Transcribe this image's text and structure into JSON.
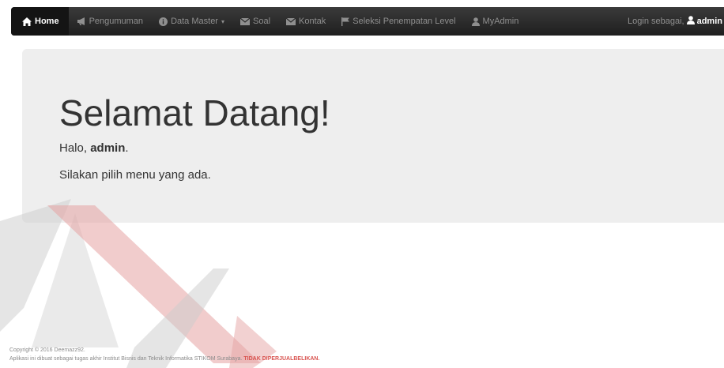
{
  "navbar": {
    "items": [
      {
        "label": "Home",
        "icon": "home-icon"
      },
      {
        "label": "Pengumuman",
        "icon": "bullhorn-icon"
      },
      {
        "label": "Data Master",
        "icon": "info-circle-icon"
      },
      {
        "label": "Soal",
        "icon": "envelope-icon"
      },
      {
        "label": "Kontak",
        "icon": "envelope-icon"
      },
      {
        "label": "Seleksi Penempatan Level",
        "icon": "flag-icon"
      },
      {
        "label": "MyAdmin",
        "icon": "user-icon"
      }
    ],
    "login_prefix": "Login sebagai,",
    "login_user": "admin"
  },
  "jumbotron": {
    "title": "Selamat Datang!",
    "greeting_prefix": "Halo,",
    "greeting_user": "admin",
    "greeting_suffix": ".",
    "message": "Silakan pilih menu yang ada."
  },
  "footer": {
    "copyright": "Copyright © 2016 Deemazz92.",
    "note": "Aplikasi ini dibuat sebagai tugas akhir Institut Bisnis dan Teknik Informatika STIKOM Surabaya.",
    "warning": "TIDAK DIPERJUALBELIKAN."
  },
  "colors": {
    "navbar_bg": "#222222",
    "jumbotron_bg": "#eeeeee",
    "warning_red": "#d9534f",
    "watermark_red": "#e8a0a0",
    "watermark_gray": "#c8c8c8"
  }
}
